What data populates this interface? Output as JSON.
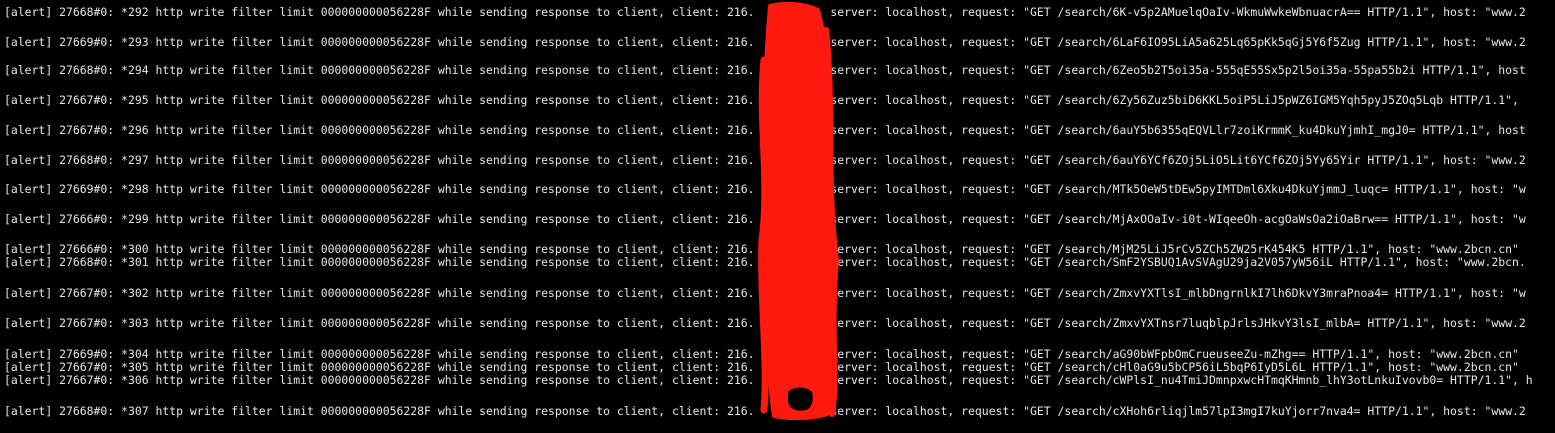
{
  "terminal": {
    "colors": {
      "background": "#000000",
      "text": "#e6e6e6",
      "redaction": "#ff1a10"
    },
    "lines": [
      "[alert] 27668#0: *292 http write filter limit 000000000056228F while sending response to client, client: 216.      .32, server: localhost, request: \"GET /search/6K-v5p2AMuelqOaIv-WkmuWwkeWbnuacrA== HTTP/1.1\", host: \"www.2",
      "[alert] 27669#0: *293 http write filter limit 000000000056228F while sending response to client, client: 216.      .32, server: localhost, request: \"GET /search/6LaF6IO95LiA5a625Lq65pKk5qGj5Y6f5Zug HTTP/1.1\", host: \"www.2",
      "[alert] 27668#0: *294 http write filter limit 000000000056228F while sending response to client, client: 216.      .32, server: localhost, request: \"GET /search/6Zeo5b2T5oi35a-555qE55Sx5p2l5oi35a-55pa55b2i HTTP/1.1\", host",
      "[alert] 27667#0: *295 http write filter limit 000000000056228F while sending response to client, client: 216.      .32, server: localhost, request: \"GET /search/6Zy56Zuz5biD6KKL5oiP5LiJ5pWZ6IGM5Yqh5pyJ5ZOq5Lqb HTTP/1.1\",",
      "[alert] 27667#0: *296 http write filter limit 000000000056228F while sending response to client, client: 216.      .32, server: localhost, request: \"GET /search/6auY5b6355qEQVLlr7zoiKrmmK_ku4DkuYjmhI_mgJ0= HTTP/1.1\", host",
      "[alert] 27668#0: *297 http write filter limit 000000000056228F while sending response to client, client: 216.      .32, server: localhost, request: \"GET /search/6auY6YCf6ZOj5LiO5Lit6YCf6ZOj5Yy65Yir HTTP/1.1\", host: \"www.2",
      "[alert] 27669#0: *298 http write filter limit 000000000056228F while sending response to client, client: 216.      .32, server: localhost, request: \"GET /search/MTk5OeW5tDEw5pyIMTDml6Xku4DkuYjmmJ_luqc= HTTP/1.1\", host: \"w",
      "[alert] 27666#0: *299 http write filter limit 000000000056228F while sending response to client, client: 216.      .32, server: localhost, request: \"GET /search/MjAxOOaIv-i0t-WIqeeOh-acgOaWsOa2iOaBrw== HTTP/1.1\", host: \"w",
      "[alert] 27666#0: *300 http write filter limit 000000000056228F while sending response to client, client: 216.      .32, server: localhost, request: \"GET /search/MjM25LiJ5rCv5ZCh5ZW25rK454K5 HTTP/1.1\", host: \"www.2bcn.cn\"",
      "[alert] 27668#0: *301 http write filter limit 000000000056228F while sending response to client, client: 216.      .32, server: localhost, request: \"GET /search/SmF2YSBUQ1AvSVAgU29ja2V057yW56iL HTTP/1.1\", host: \"www.2bcn.",
      "[alert] 27667#0: *302 http write filter limit 000000000056228F while sending response to client, client: 216.      .32, server: localhost, request: \"GET /search/ZmxvYXTlsI_mlbDngrnlkI7lh6DkvY3mraPnoa4= HTTP/1.1\", host: \"w",
      "[alert] 27667#0: *303 http write filter limit 000000000056228F while sending response to client, client: 216.      .32, server: localhost, request: \"GET /search/ZmxvYXTnsr7luqblpJrlsJHkvY3lsI_mlbA= HTTP/1.1\", host: \"www.2",
      "[alert] 27669#0: *304 http write filter limit 000000000056228F while sending response to client, client: 216.      .32, server: localhost, request: \"GET /search/aG90bWFpbOmCrueuseeZu-mZhg== HTTP/1.1\", host: \"www.2bcn.cn\"",
      "[alert] 27667#0: *305 http write filter limit 000000000056228F while sending response to client, client: 216.      .32, server: localhost, request: \"GET /search/cHl0aG9u5bCP56iL5bqP6IyD5L6L HTTP/1.1\", host: \"www.2bcn.cn\"",
      "[alert] 27667#0: *306 http write filter limit 000000000056228F while sending response to client, client: 216.      .32, server: localhost, request: \"GET /search/cWPlsI_nu4TmiJDmnpxwcHTmqKHmnb_lhY3otLnkuIvovb0= HTTP/1.1\", h",
      "[alert] 27668#0: *307 http write filter limit 000000000056228F while sending response to client, client: 216.      .32, server: localhost, request: \"GET /search/cXHoh6rliqjlm57lpI3mgI7kuYjorr7nva4= HTTP/1.1\", host: \"www.2"
    ]
  }
}
